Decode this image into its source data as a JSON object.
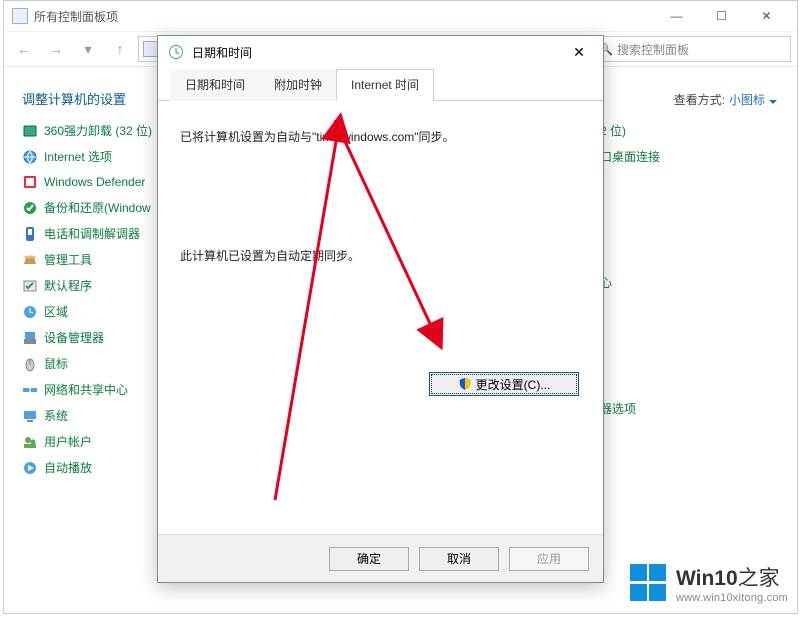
{
  "cp_window": {
    "title": "所有控制面板项",
    "search_placeholder": "搜索控制面板",
    "heading": "调整计算机的设置",
    "view_label": "查看方式:",
    "view_value": "小图标"
  },
  "items_left": [
    "360强力卸载 (32 位)",
    "Internet 选项",
    "Windows Defender",
    "备份和还原(Window",
    "电话和调制解调器",
    "管理工具",
    "默认程序",
    "区域",
    "设备管理器",
    "鼠标",
    "网络和共享中心",
    "系统",
    "用户帐户",
    "自动播放"
  ],
  "items_right": [
    "2 位)",
    "口桌面连接",
    "心",
    "器选项"
  ],
  "dialog": {
    "title": "日期和时间",
    "tabs": [
      "日期和时间",
      "附加时钟",
      "Internet 时间"
    ],
    "active_tab": 2,
    "sync_line": "已将计算机设置为自动与\"time.windows.com\"同步。",
    "auto_line": "此计算机已设置为自动定期同步。",
    "change_btn": "更改设置(C)...",
    "ok": "确定",
    "cancel": "取消",
    "apply": "应用"
  },
  "watermark": {
    "brand": "Win10",
    "suffix": "之家",
    "url": "www.win10xitong.com"
  }
}
